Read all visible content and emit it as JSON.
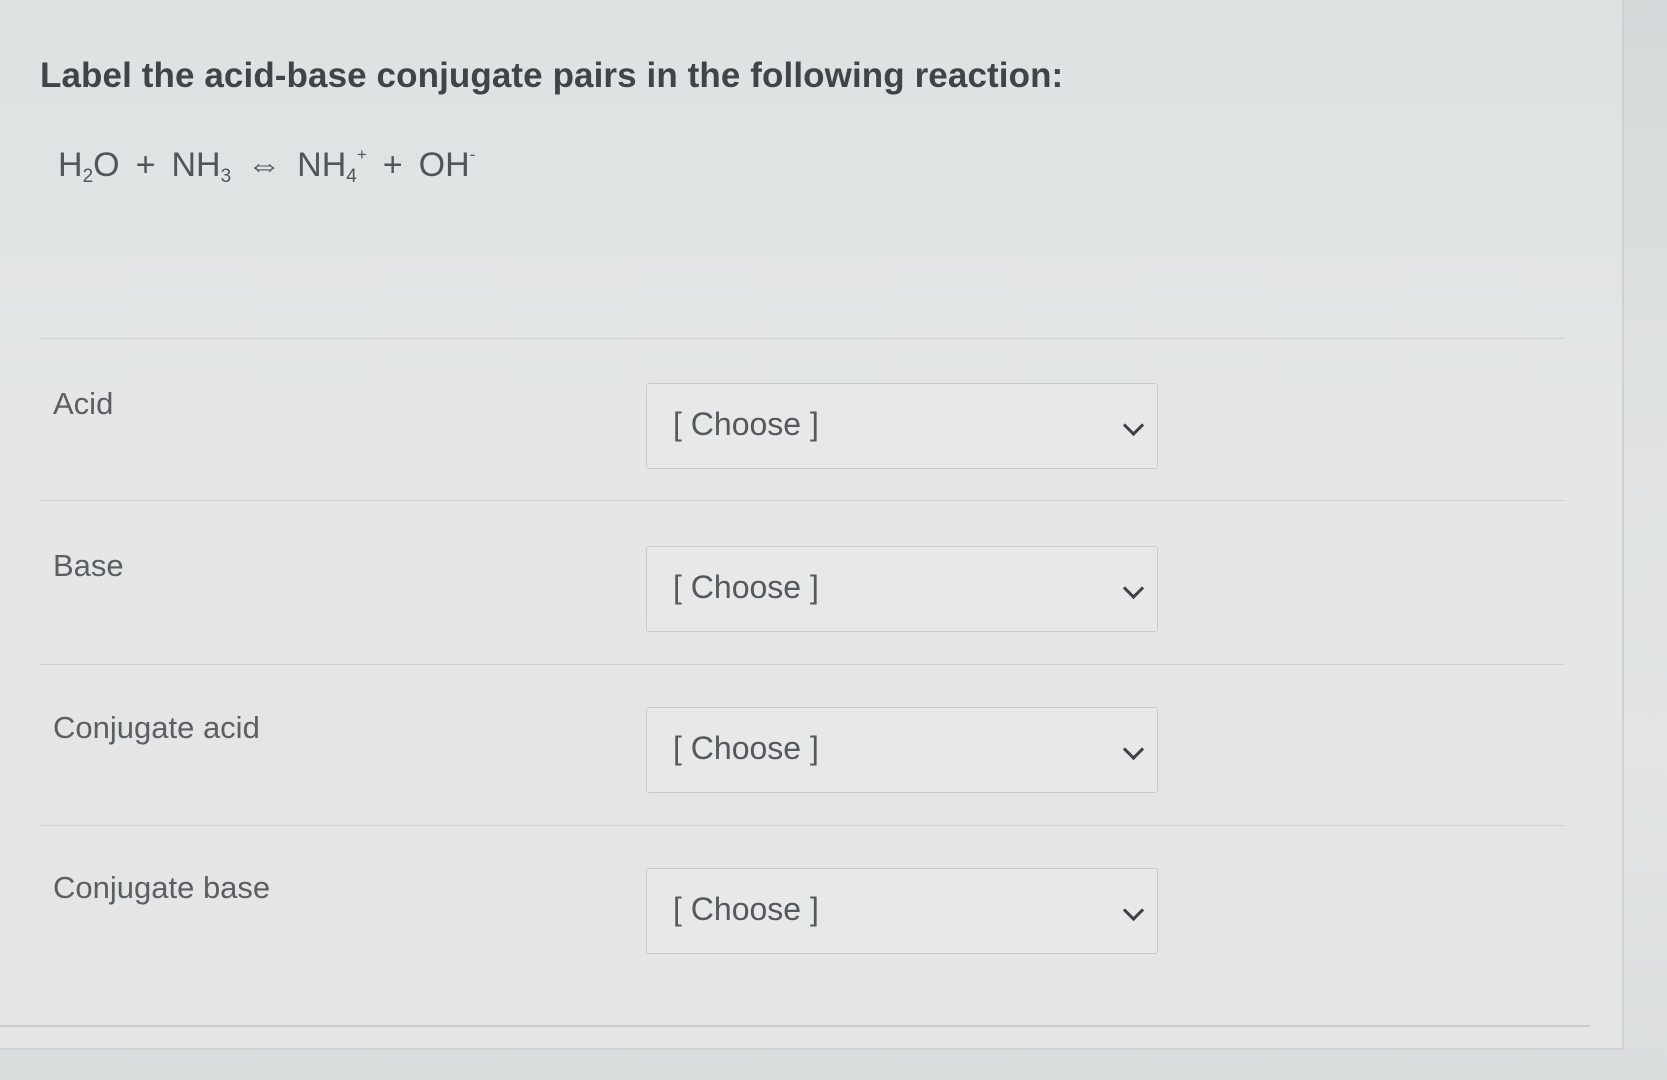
{
  "question": {
    "title": "Label the acid-base conjugate pairs in the following reaction:"
  },
  "equation": {
    "reactant1_base": "H",
    "reactant1_sub": "2",
    "reactant1_tail": "O",
    "plus1": "+",
    "reactant2_base": "NH",
    "reactant2_sub": "3",
    "arrow": "⇔",
    "product1_base": "NH",
    "product1_sub": "4",
    "product1_sup": "+",
    "plus2": "+",
    "product2_base": "OH",
    "product2_sup": "-"
  },
  "rows": [
    {
      "label": "Acid",
      "select_value": "[ Choose ]"
    },
    {
      "label": "Base",
      "select_value": "[ Choose ]"
    },
    {
      "label": "Conjugate acid",
      "select_value": "[ Choose ]"
    },
    {
      "label": "Conjugate base",
      "select_value": "[ Choose ]"
    }
  ],
  "icons": {
    "dropdown": "chevron-down-icon"
  }
}
